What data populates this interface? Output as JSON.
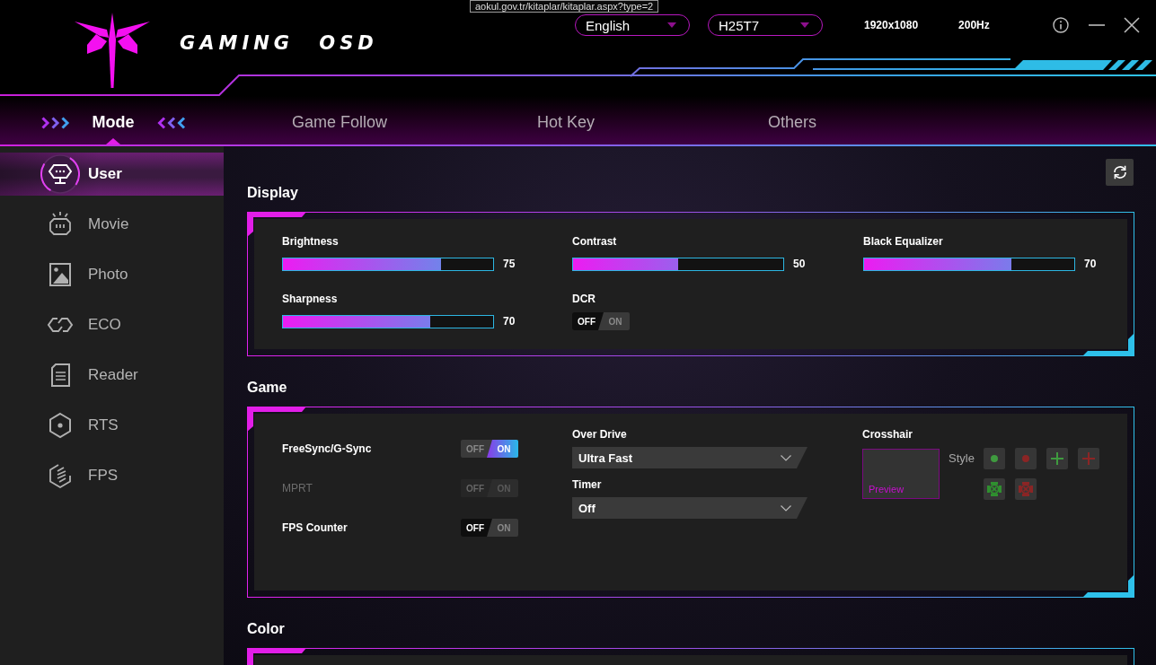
{
  "tooltip": {
    "text": "aokul.gov.tr/kitaplar/kitaplar.aspx?type=2"
  },
  "header": {
    "logo_text": "GAMING OSD",
    "selects": [
      {
        "value": "English"
      },
      {
        "value": "H25T7"
      }
    ],
    "resolution": "1920x1080",
    "refresh_rate": "200Hz"
  },
  "tabs": [
    {
      "label": "Mode",
      "selected": true
    },
    {
      "label": "Game Follow",
      "selected": false
    },
    {
      "label": "Hot Key",
      "selected": false
    },
    {
      "label": "Others",
      "selected": false
    }
  ],
  "sidebar": {
    "items": [
      {
        "label": "User",
        "selected": true
      },
      {
        "label": "Movie",
        "selected": false
      },
      {
        "label": "Photo",
        "selected": false
      },
      {
        "label": "ECO",
        "selected": false
      },
      {
        "label": "Reader",
        "selected": false
      },
      {
        "label": "RTS",
        "selected": false
      },
      {
        "label": "FPS",
        "selected": false
      }
    ]
  },
  "display": {
    "title": "Display",
    "controls": [
      {
        "kind": "slider",
        "label": "Brightness",
        "level": 0.75,
        "reading": "75"
      },
      {
        "kind": "slider",
        "label": "Contrast",
        "level": 0.5,
        "reading": "50"
      },
      {
        "kind": "slider",
        "label": "Black Equalizer",
        "level": 0.7,
        "reading": "70"
      },
      {
        "kind": "slider",
        "label": "Sharpness",
        "level": 0.7,
        "reading": "70"
      },
      {
        "kind": "switch",
        "label": "DCR",
        "on": false,
        "disabled": false,
        "off_label": "OFF",
        "on_label": "ON"
      }
    ]
  },
  "game": {
    "title": "Game",
    "switches": [
      {
        "label": "FreeSync/G-Sync",
        "on": true,
        "disabled": false,
        "off_label": "OFF",
        "on_label": "ON"
      },
      {
        "label": "MPRT",
        "on": false,
        "disabled": true,
        "off_label": "OFF",
        "on_label": "ON"
      },
      {
        "label": "FPS Counter",
        "on": false,
        "disabled": false,
        "off_label": "OFF",
        "on_label": "ON"
      }
    ],
    "dropdowns": [
      {
        "label": "Over Drive",
        "value": "Ultra Fast"
      },
      {
        "label": "Timer",
        "value": "Off"
      }
    ],
    "crosshair": {
      "label": "Crosshair",
      "preview_label": "Preview",
      "style_label": "Style",
      "styles": [
        {
          "kind": "dot",
          "color": "#3f9a3f"
        },
        {
          "kind": "dot",
          "color": "#8b2525"
        },
        {
          "kind": "plus",
          "color": "#3f9a3f"
        },
        {
          "kind": "plus",
          "color": "#8b2525"
        },
        {
          "kind": "target",
          "color": "#2f8f2f"
        },
        {
          "kind": "target",
          "color": "#8b2525"
        }
      ]
    }
  },
  "color": {
    "title": "Color"
  }
}
